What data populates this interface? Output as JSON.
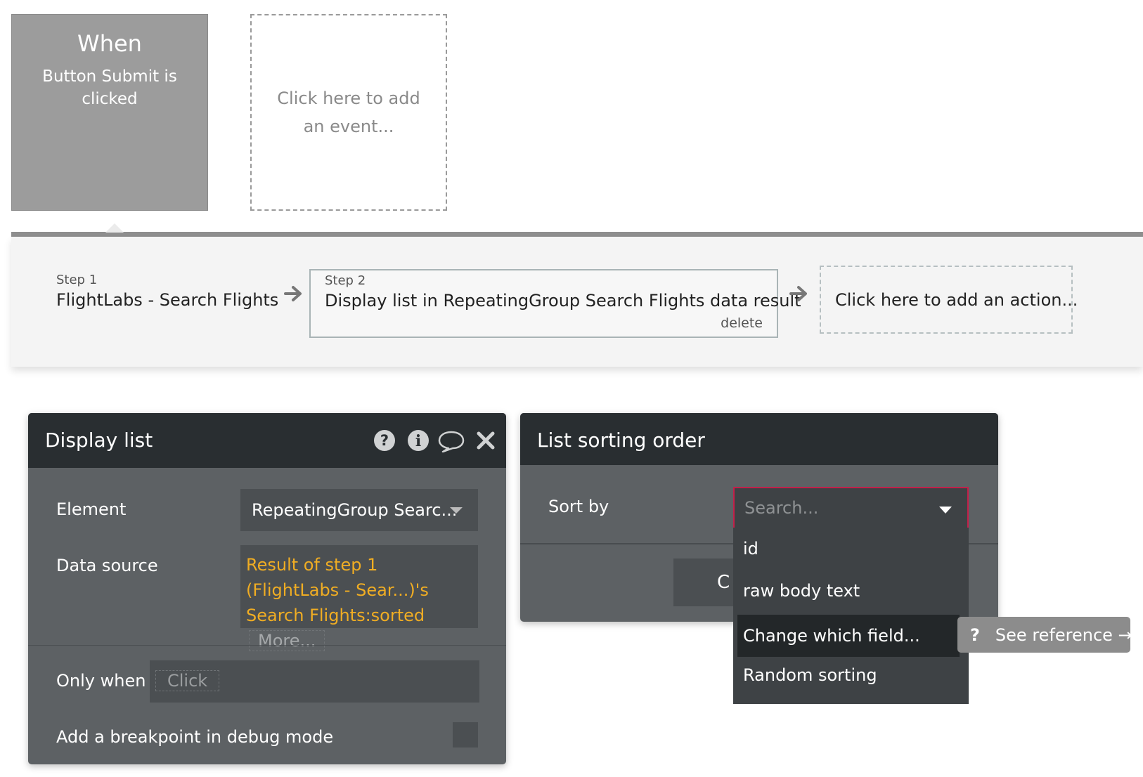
{
  "event_when": {
    "title": "When",
    "subtitle": "Button Submit is clicked"
  },
  "event_add": {
    "label": "Click here to add an event..."
  },
  "workflow": {
    "step1": {
      "number": "Step 1",
      "name": "FlightLabs - Search Flights"
    },
    "step2": {
      "number": "Step 2",
      "name": "Display list in RepeatingGroup Search Flights data result",
      "delete_label": "delete"
    },
    "add_action": "Click here to add an action..."
  },
  "display_list": {
    "title": "Display list",
    "icons": [
      "help-icon",
      "info-icon",
      "comment-icon",
      "close-icon"
    ],
    "element_label": "Element",
    "element_value": "RepeatingGroup Searc...",
    "data_source_label": "Data source",
    "data_source_value": "Result of step 1 (FlightLabs - Sear...)'s Search Flights:sorted",
    "data_source_more": "More...",
    "only_when_label": "Only when",
    "only_when_placeholder": "Click",
    "breakpoint_label": "Add a breakpoint in debug mode"
  },
  "sorting": {
    "title": "List sorting order",
    "sort_by_label": "Sort by",
    "search_placeholder": "Search...",
    "confirm_visible": "C",
    "options": [
      "id",
      "raw body text",
      "Change which field...",
      "Random sorting"
    ],
    "highlighted_option": "Change which field..."
  },
  "tooltip": {
    "icon": "?",
    "label": "See reference →"
  },
  "colors": {
    "accent_orange": "#f0ad23",
    "focus_border": "#c2204a",
    "panel_header": "#292e31",
    "panel_body": "#5d6164"
  }
}
